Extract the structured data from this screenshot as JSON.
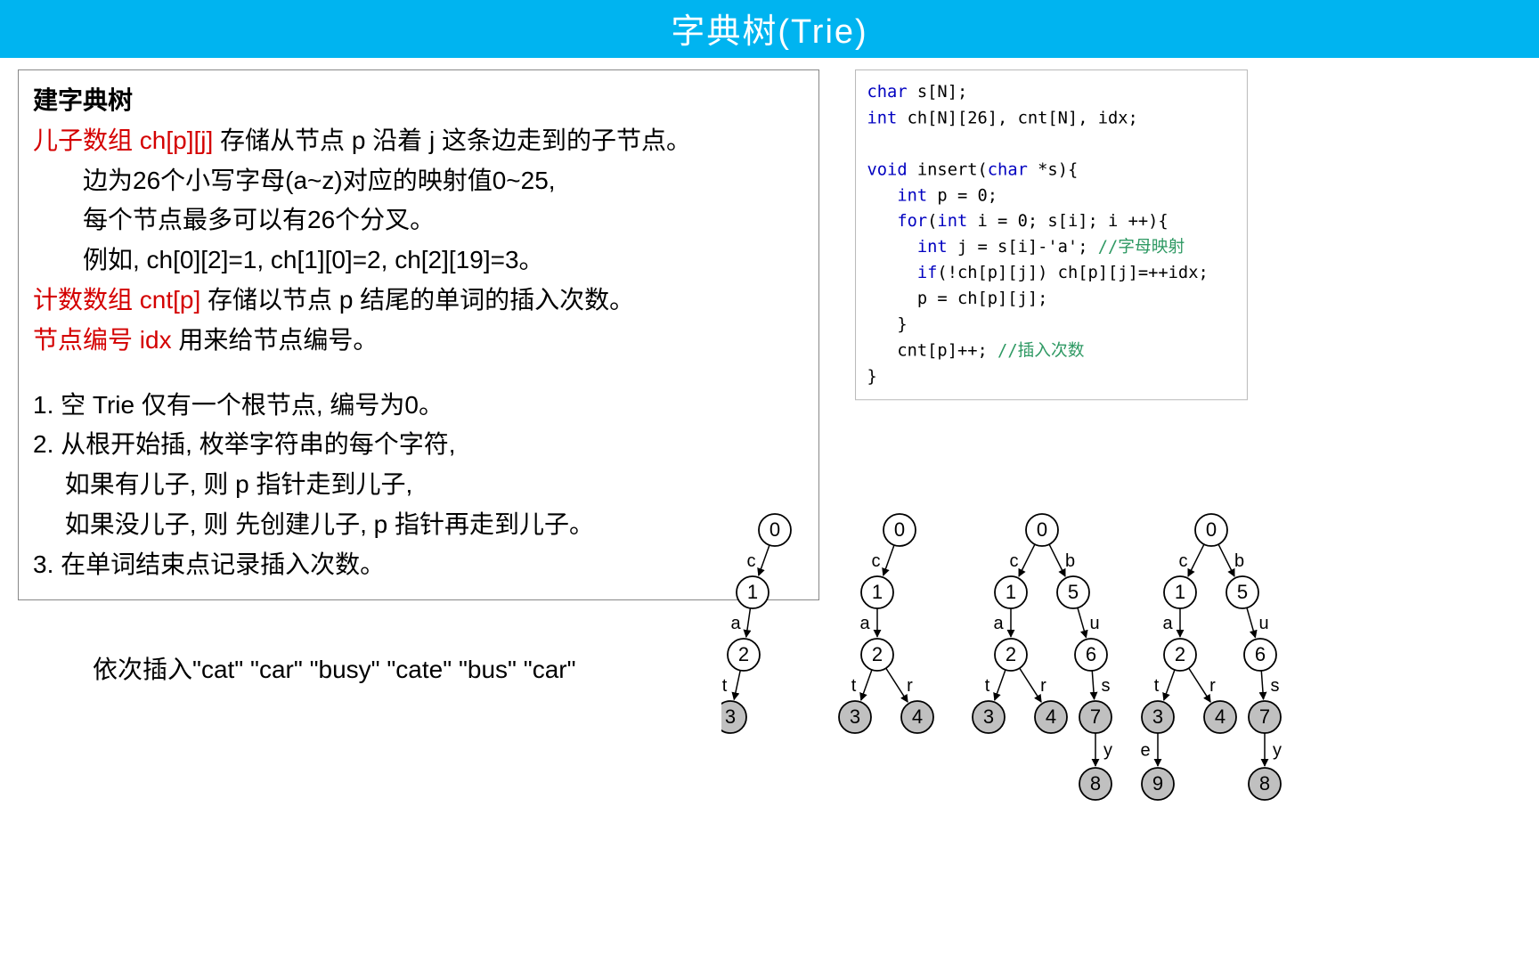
{
  "header": {
    "title": "字典树(Trie)"
  },
  "left": {
    "h1": "建字典树",
    "p1_a": "儿子数组 ch[p][j]",
    "p1_b": " 存储从节点 p 沿着 j 这条边走到的子节点。",
    "p2": "　　边为26个小写字母(a~z)对应的映射值0~25,",
    "p3": "　　每个节点最多可以有26个分叉。",
    "p4": "　　例如,  ch[0][2]=1, ch[1][0]=2, ch[2][19]=3。",
    "p5_a": "计数数组 cnt[p]",
    "p5_b": " 存储以节点 p 结尾的单词的插入次数。",
    "p6_a": "节点编号 idx",
    "p6_b": " 用来给节点编号。",
    "l1": "1.  空 Trie 仅有一个根节点,  编号为0。",
    "l2": "2.  从根开始插,  枚举字符串的每个字符,",
    "l3": "　  如果有儿子,  则 p 指针走到儿子,",
    "l4": "　  如果没儿子,  则 先创建儿子,  p 指针再走到儿子。",
    "l5": "3.  在单词结束点记录插入次数。"
  },
  "insert_line": "依次插入\"cat\" \"car\" \"busy\" \"cate\" \"bus\" \"car\"",
  "code": {
    "l1": {
      "t1": "char",
      "r1": " s[N];"
    },
    "l2": {
      "t1": "int",
      "r1": " ch[N][26], cnt[N], idx;"
    },
    "l3": "",
    "l4": {
      "t1": "void",
      "r1": " insert(",
      "t2": "char",
      "r2": " *s){"
    },
    "l5": {
      "sp": "   ",
      "t1": "int",
      "r1": " p = 0;"
    },
    "l6": {
      "sp": "   ",
      "t1": "for",
      "r1": "(",
      "t2": "int",
      "r2": " i = 0; s[i]; i ++){"
    },
    "l7": {
      "sp": "     ",
      "t1": "int",
      "r1": " j = s[i]-'a'; ",
      "c1": "//字母映射"
    },
    "l8": {
      "sp": "     ",
      "t1": "if",
      "r1": "(!ch[p][j]) ch[p][j]=++idx;"
    },
    "l9": {
      "sp": "     ",
      "r1": "p = ch[p][j];"
    },
    "l10": {
      "sp": "   ",
      "r1": "}"
    },
    "l11": {
      "sp": "   ",
      "r1": "cnt[p]++; ",
      "c1": "//插入次数"
    },
    "l12": "}"
  },
  "trees": [
    {
      "ox": 0,
      "nodes": [
        [
          60,
          25,
          "0",
          0
        ],
        [
          35,
          95,
          "1",
          0
        ],
        [
          25,
          165,
          "2",
          0
        ],
        [
          10,
          235,
          "3",
          1
        ]
      ],
      "edges": [
        [
          60,
          25,
          35,
          95,
          "c",
          "l"
        ],
        [
          35,
          95,
          25,
          165,
          "a",
          "l"
        ],
        [
          25,
          165,
          10,
          235,
          "t",
          "l"
        ]
      ]
    },
    {
      "ox": 140,
      "nodes": [
        [
          60,
          25,
          "0",
          0
        ],
        [
          35,
          95,
          "1",
          0
        ],
        [
          35,
          165,
          "2",
          0
        ],
        [
          10,
          235,
          "3",
          1
        ],
        [
          80,
          235,
          "4",
          1
        ]
      ],
      "edges": [
        [
          60,
          25,
          35,
          95,
          "c",
          "l"
        ],
        [
          35,
          95,
          35,
          165,
          "a",
          "l"
        ],
        [
          35,
          165,
          10,
          235,
          "t",
          "l"
        ],
        [
          35,
          165,
          80,
          235,
          "r",
          "r"
        ]
      ]
    },
    {
      "ox": 290,
      "nodes": [
        [
          70,
          25,
          "0",
          0
        ],
        [
          35,
          95,
          "1",
          0
        ],
        [
          105,
          95,
          "5",
          0
        ],
        [
          35,
          165,
          "2",
          0
        ],
        [
          125,
          165,
          "6",
          0
        ],
        [
          10,
          235,
          "3",
          1
        ],
        [
          80,
          235,
          "4",
          1
        ],
        [
          130,
          235,
          "7",
          1
        ],
        [
          130,
          310,
          "8",
          1
        ]
      ],
      "edges": [
        [
          70,
          25,
          35,
          95,
          "c",
          "l"
        ],
        [
          70,
          25,
          105,
          95,
          "b",
          "r"
        ],
        [
          35,
          95,
          35,
          165,
          "a",
          "l"
        ],
        [
          105,
          95,
          125,
          165,
          "u",
          "r"
        ],
        [
          35,
          165,
          10,
          235,
          "t",
          "l"
        ],
        [
          35,
          165,
          80,
          235,
          "r",
          "r"
        ],
        [
          125,
          165,
          130,
          235,
          "s",
          "r"
        ],
        [
          130,
          235,
          130,
          310,
          "y",
          "r"
        ]
      ]
    },
    {
      "ox": 480,
      "nodes": [
        [
          70,
          25,
          "0",
          0
        ],
        [
          35,
          95,
          "1",
          0
        ],
        [
          105,
          95,
          "5",
          0
        ],
        [
          35,
          165,
          "2",
          0
        ],
        [
          125,
          165,
          "6",
          0
        ],
        [
          10,
          235,
          "3",
          1
        ],
        [
          80,
          235,
          "4",
          1
        ],
        [
          130,
          235,
          "7",
          1
        ],
        [
          10,
          310,
          "9",
          1
        ],
        [
          130,
          310,
          "8",
          1
        ]
      ],
      "edges": [
        [
          70,
          25,
          35,
          95,
          "c",
          "l"
        ],
        [
          70,
          25,
          105,
          95,
          "b",
          "r"
        ],
        [
          35,
          95,
          35,
          165,
          "a",
          "l"
        ],
        [
          105,
          95,
          125,
          165,
          "u",
          "r"
        ],
        [
          35,
          165,
          10,
          235,
          "t",
          "l"
        ],
        [
          35,
          165,
          80,
          235,
          "r",
          "r"
        ],
        [
          125,
          165,
          130,
          235,
          "s",
          "r"
        ],
        [
          10,
          235,
          10,
          310,
          "e",
          "l"
        ],
        [
          130,
          235,
          130,
          310,
          "y",
          "r"
        ]
      ]
    }
  ]
}
